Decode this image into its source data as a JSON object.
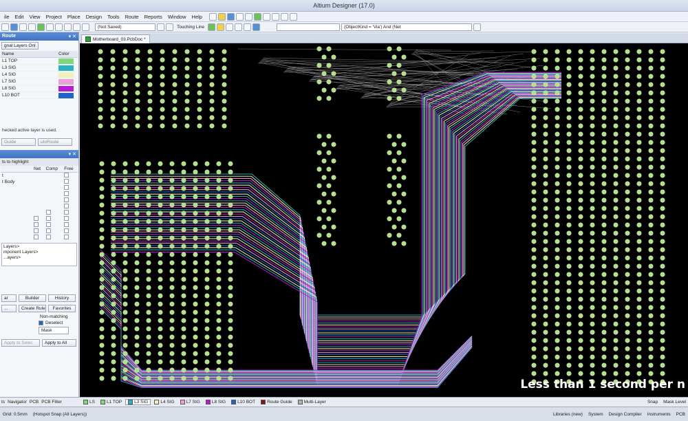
{
  "window": {
    "title": "Altium Designer (17.0)"
  },
  "menu": [
    "ile",
    "Edit",
    "View",
    "Project",
    "Place",
    "Design",
    "Tools",
    "Route",
    "Reports",
    "Window",
    "Help"
  ],
  "toolbar": {
    "doc_state": "(Not Saved)",
    "mode": "Touching Line",
    "filter_query": "(ObjectKind = 'Via') And (Net"
  },
  "panel": {
    "title": "Route",
    "signal_layers_only": "gnal Layers Onl",
    "columns": {
      "name": "Name",
      "color": "Color"
    },
    "layers": [
      {
        "name": "L1 TOP",
        "color": "#7fd87a"
      },
      {
        "name": "L3 SIG",
        "color": "#2bb3c3"
      },
      {
        "name": "L4 SIG",
        "color": "#f3f0bf"
      },
      {
        "name": "L7 SIG",
        "color": "#e8a2d8"
      },
      {
        "name": "L8 SIG",
        "color": "#b81ccf"
      },
      {
        "name": "L10 BOT",
        "color": "#1f64c8"
      }
    ],
    "note": "hecked active layer is used.",
    "guide_btn": "Guide",
    "autoroute_btn": "utoRoute",
    "highlight_head": "ts to highlight",
    "hl_columns": {
      "net": "Net",
      "comp": "Comp",
      "free": "Free"
    },
    "hl_rows": [
      "t",
      "t Body"
    ],
    "list_items": [
      "Layers>",
      "mponent Layers>",
      "...ayers>"
    ],
    "buttons": {
      "b1": "ar",
      "builder": "Builder",
      "history": "History",
      "b4": "...",
      "create_rule": "Create Rule",
      "favorites": "Favorites"
    },
    "non_matching": "Non-matching",
    "deselect": "Deselect",
    "mask": "Mask",
    "apply_sel": "Apply to Selec",
    "apply_all": "Apply to All"
  },
  "document": {
    "tab": "Motherboard_03.PcbDoc *"
  },
  "overlay_text": "Less than 1 second per n",
  "left_tabs": [
    "ts",
    "Navigator",
    "PCB",
    "PCB Filter"
  ],
  "layer_tabs": [
    {
      "label": "LS",
      "color": "#7fd87a"
    },
    {
      "label": "L1 TOP",
      "color": "#7fd87a"
    },
    {
      "label": "L3 SIG",
      "color": "#2bb3c3",
      "active": true
    },
    {
      "label": "L4 SIG",
      "color": "#f3f0bf"
    },
    {
      "label": "L7 SIG",
      "color": "#e8a2d8"
    },
    {
      "label": "L8 SIG",
      "color": "#b81ccf"
    },
    {
      "label": "L10 BOT",
      "color": "#1f64c8"
    },
    {
      "label": "Route Guide",
      "color": "#7a1a1a"
    },
    {
      "label": "Multi-Layer",
      "color": "#b0b0b0"
    }
  ],
  "snap": "Snap",
  "mask_level": "Mask Level",
  "status": {
    "coords": "Grid: 0.5mm",
    "snap": "(Hotspot Snap (All Layers))",
    "right": [
      "Libraries (new)",
      "System",
      "Design Compiler",
      "Instruments",
      "PCB"
    ]
  }
}
